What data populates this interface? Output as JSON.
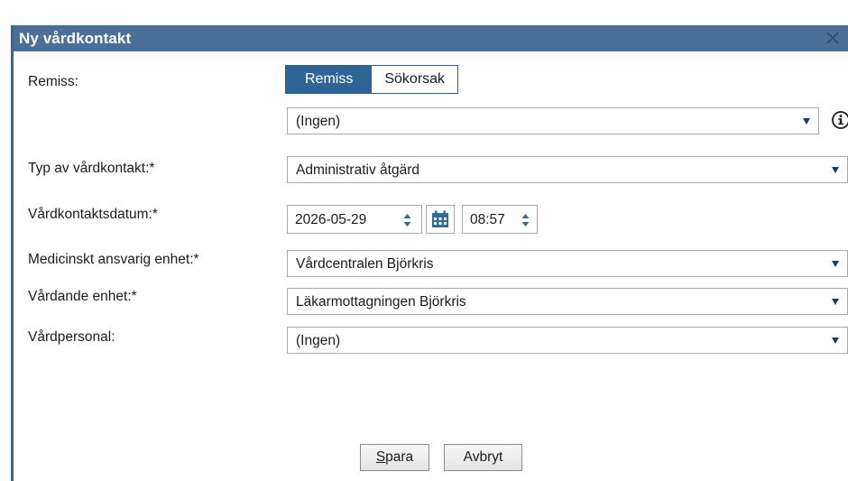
{
  "dialog": {
    "title": "Ny vårdkontakt"
  },
  "remiss": {
    "label": "Remiss:",
    "toggle": {
      "active_label": "Remiss",
      "inactive_label": "Sökorsak"
    },
    "selected_value": "(Ingen)"
  },
  "typ": {
    "label": "Typ av vårdkontakt:*",
    "selected_value": "Administrativ åtgärd"
  },
  "datum": {
    "label": "Vårdkontaktsdatum:*",
    "date_value": "2026-05-29",
    "time_value": "08:57"
  },
  "medicinskt": {
    "label": "Medicinskt ansvarig enhet:*",
    "selected_value": "Vårdcentralen Björkris"
  },
  "vardande": {
    "label": "Vårdande enhet:*",
    "selected_value": "Läkarmottagningen Björkris"
  },
  "personal": {
    "label": "Vårdpersonal:",
    "selected_value": "(Ingen)"
  },
  "buttons": {
    "save_mnemonic": "S",
    "save_rest": "para",
    "cancel_label": "Avbryt"
  },
  "icons": {
    "close": "close-icon",
    "info": "info-icon",
    "calendar": "calendar-icon",
    "dropdown": "chevron-down-icon",
    "spinner": "spinner-icon"
  },
  "colors": {
    "titlebar": "#4a7099",
    "accent": "#2f6496",
    "calendar": "#2a6e9e"
  }
}
